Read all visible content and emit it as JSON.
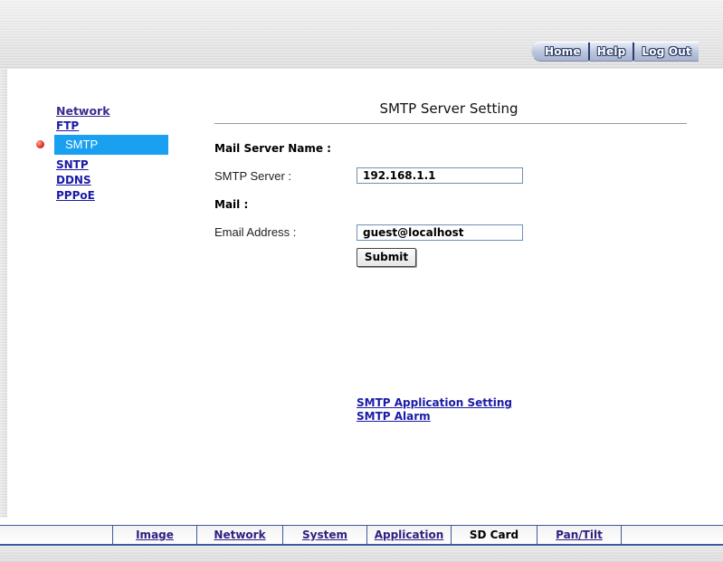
{
  "header": {
    "nav": [
      {
        "label": "Home"
      },
      {
        "label": "Help"
      },
      {
        "label": "Log Out"
      }
    ]
  },
  "sidebar": {
    "items": [
      {
        "label": "Network",
        "active": false
      },
      {
        "label": "FTP",
        "active": false
      },
      {
        "label": "SMTP",
        "active": true
      },
      {
        "label": "SNTP",
        "active": false
      },
      {
        "label": "DDNS",
        "active": false
      },
      {
        "label": "PPPoE",
        "active": false
      }
    ]
  },
  "main": {
    "title": "SMTP Server Setting",
    "mail_server_section": "Mail Server Name :",
    "smtp_server_label": "SMTP Server :",
    "smtp_server_value": "192.168.1.1",
    "mail_section": "Mail :",
    "email_label": "Email Address :",
    "email_value": "guest@localhost",
    "submit_label": "Submit",
    "links": [
      {
        "label": "SMTP Application Setting"
      },
      {
        "label": "SMTP Alarm"
      }
    ]
  },
  "bottom_nav": {
    "items": [
      {
        "label": "Image",
        "current": false
      },
      {
        "label": "Network",
        "current": false
      },
      {
        "label": "System",
        "current": false
      },
      {
        "label": "Application",
        "current": false
      },
      {
        "label": "SD Card",
        "current": true
      },
      {
        "label": "Pan/Tilt",
        "current": false
      }
    ]
  },
  "colors": {
    "active_item_bg": "#1aa0f0",
    "link": "#1a1aa6",
    "nav_border": "#3c5aa0"
  }
}
